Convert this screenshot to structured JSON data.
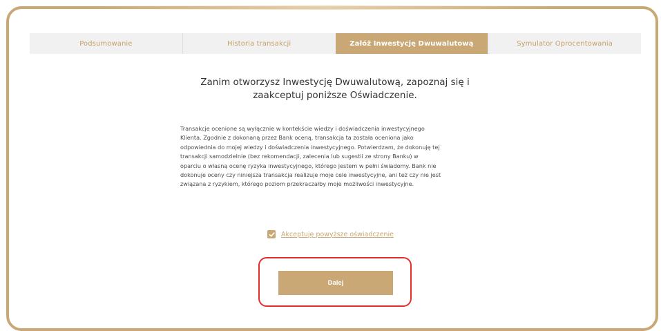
{
  "tabs": [
    {
      "label": "Podsumowanie",
      "active": false
    },
    {
      "label": "Historia transakcji",
      "active": false
    },
    {
      "label": "Załóż Inwestycję Dwuwalutową",
      "active": true
    },
    {
      "label": "Symulator Oprocentowania",
      "active": false
    }
  ],
  "heading": {
    "line1": "Zanim otworzysz Inwestycję Dwuwalutową, zapoznaj się i",
    "line2": "zaakceptuj poniższe Oświadczenie."
  },
  "statement": {
    "lines": [
      "Transakcje ocenione są wyłącznie w kontekście wiedzy i doświadczenia inwestycyjnego",
      "Klienta. Zgodnie z dokonaną przez Bank oceną, transakcja ta została oceniona jako",
      "odpowiednia do mojej wiedzy i doświadczenia inwestycyjnego. Potwierdzam, że dokonuję tej",
      "transakcji samodzielnie (bez rekomendacji, zalecenia lub sugestii ze strony Banku) w",
      "oparciu o własną ocenę ryzyka inwestycyjnego, którego jestem w pełni świadomy. Bank nie",
      "dokonuje oceny czy niniejsza transakcja realizuje moje cele inwestycyjne, ani też czy nie jest",
      "związana z ryzykiem, którego poziom przekraczałby moje możliwości inwestycyjne."
    ]
  },
  "accept": {
    "checked": true,
    "label": "Akceptuję powyższe oświadczenie"
  },
  "next_button": {
    "label": "Dalej"
  },
  "colors": {
    "accent": "#c9a876",
    "highlight": "#e32d2d"
  }
}
